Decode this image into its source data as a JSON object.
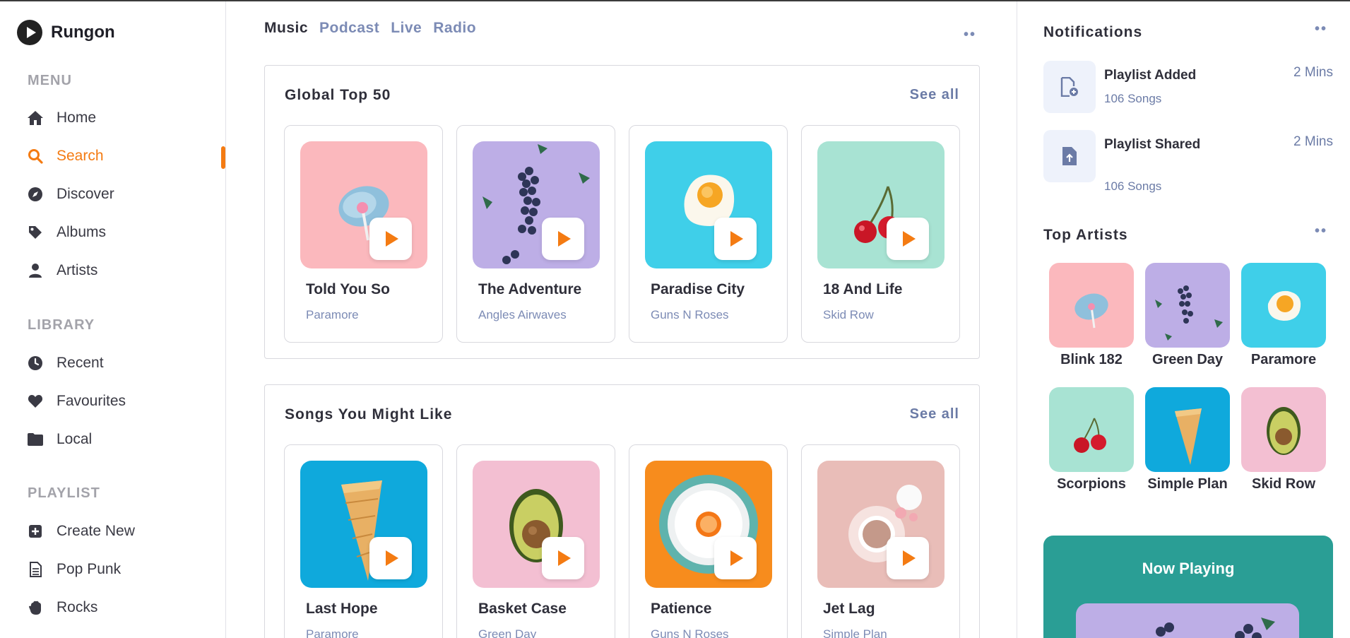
{
  "app": {
    "name": "Rungon"
  },
  "sidebar": {
    "menu_title": "MENU",
    "menu": [
      {
        "label": "Home",
        "icon": "home-icon"
      },
      {
        "label": "Search",
        "icon": "search-icon",
        "active": true
      },
      {
        "label": "Discover",
        "icon": "compass-icon"
      },
      {
        "label": "Albums",
        "icon": "tag-icon"
      },
      {
        "label": "Artists",
        "icon": "user-icon"
      }
    ],
    "library_title": "LIBRARY",
    "library": [
      {
        "label": "Recent",
        "icon": "clock-icon"
      },
      {
        "label": "Favourites",
        "icon": "heart-icon"
      },
      {
        "label": "Local",
        "icon": "folder-icon"
      }
    ],
    "playlist_title": "PLAYLIST",
    "playlist": [
      {
        "label": "Create New",
        "icon": "plus-square-icon"
      },
      {
        "label": "Pop Punk",
        "icon": "document-icon"
      },
      {
        "label": "Rocks",
        "icon": "hand-icon"
      }
    ]
  },
  "main": {
    "tabs": [
      "Music",
      "Podcast",
      "Live",
      "Radio"
    ],
    "active_tab": "Music",
    "global_top": {
      "title": "Global Top 50",
      "see_all": "See all",
      "cards": [
        {
          "title": "Told You So",
          "artist": "Paramore",
          "art": "lollipop"
        },
        {
          "title": "The Adventure",
          "artist": "Angles Airwaves",
          "art": "blueberries"
        },
        {
          "title": "Paradise City",
          "artist": "Guns N Roses",
          "art": "egg"
        },
        {
          "title": "18 And Life",
          "artist": "Skid Row",
          "art": "cherries"
        }
      ]
    },
    "songs_like": {
      "title": "Songs You Might Like",
      "see_all": "See all",
      "cards": [
        {
          "title": "Last Hope",
          "artist": "Paramore",
          "art": "cone"
        },
        {
          "title": "Basket Case",
          "artist": "Green Day",
          "art": "avocado"
        },
        {
          "title": "Patience",
          "artist": "Guns N Roses",
          "art": "plate"
        },
        {
          "title": "Jet Lag",
          "artist": "Simple Plan",
          "art": "coffee"
        }
      ]
    }
  },
  "right": {
    "notifications_title": "Notifications",
    "notifications": [
      {
        "title": "Playlist Added",
        "sub": "106 Songs",
        "time": "2 Mins",
        "icon": "file-add-icon"
      },
      {
        "title": "Playlist Shared",
        "sub": "106 Songs",
        "time": "2 Mins",
        "icon": "file-upload-icon"
      }
    ],
    "top_artists_title": "Top Artists",
    "artists": [
      {
        "name": "Blink 182",
        "art": "lollipop"
      },
      {
        "name": "Green Day",
        "art": "blueberries"
      },
      {
        "name": "Paramore",
        "art": "egg"
      },
      {
        "name": "Scorpions",
        "art": "cherries"
      },
      {
        "name": "Simple Plan",
        "art": "cone"
      },
      {
        "name": "Skid Row",
        "art": "avocado"
      }
    ],
    "now_playing_title": "Now Playing"
  },
  "colors": {
    "accent": "#f47b12",
    "link": "#7c8bb5",
    "teal": "#2a9e95"
  }
}
